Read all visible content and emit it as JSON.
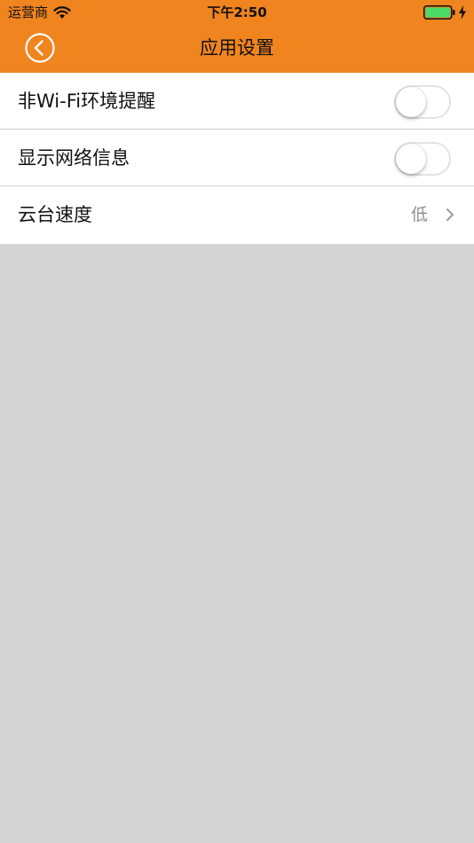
{
  "status_bar": {
    "carrier": "运营商",
    "time": "下午2:50",
    "battery_color": "#4cd964"
  },
  "nav": {
    "title": "应用设置",
    "back_icon": "back-circle-icon",
    "bar_color": "#f0841e"
  },
  "settings": {
    "items": [
      {
        "label": "非Wi-Fi环境提醒",
        "control": "toggle",
        "enabled": false
      },
      {
        "label": "显示网络信息",
        "control": "toggle",
        "enabled": false
      },
      {
        "label": "云台速度",
        "control": "value",
        "value": "低",
        "icon": "chevron-right-icon"
      }
    ]
  }
}
